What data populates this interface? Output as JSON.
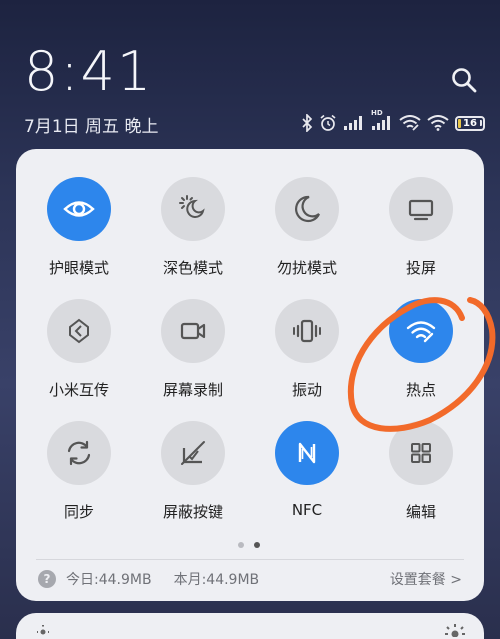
{
  "status": {
    "time": "8:41",
    "date": "7月1日 周五 晚上",
    "network_label": "HD",
    "battery_level": "16"
  },
  "tiles": [
    {
      "label": "护眼模式",
      "icon": "eye-icon",
      "active": true
    },
    {
      "label": "深色模式",
      "icon": "sun-moon-icon",
      "active": false
    },
    {
      "label": "勿扰模式",
      "icon": "moon-icon",
      "active": false
    },
    {
      "label": "投屏",
      "icon": "screen-cast-icon",
      "active": false
    },
    {
      "label": "小米互传",
      "icon": "mi-share-icon",
      "active": false
    },
    {
      "label": "屏幕录制",
      "icon": "video-camera-icon",
      "active": false
    },
    {
      "label": "振动",
      "icon": "vibrate-icon",
      "active": false
    },
    {
      "label": "热点",
      "icon": "hotspot-icon",
      "active": true
    },
    {
      "label": "同步",
      "icon": "sync-icon",
      "active": false
    },
    {
      "label": "屏蔽按键",
      "icon": "block-keys-icon",
      "active": false
    },
    {
      "label": "NFC",
      "icon": "nfc-icon",
      "active": true
    },
    {
      "label": "编辑",
      "icon": "grid-edit-icon",
      "active": false
    }
  ],
  "pager": {
    "current": 2,
    "total": 2
  },
  "usage": {
    "help_glyph": "?",
    "today": "今日:44.9MB",
    "month": "本月:44.9MB",
    "settings_link": "设置套餐 >"
  },
  "colors": {
    "accent": "#2d86ec",
    "annotation": "#f26a2a"
  }
}
